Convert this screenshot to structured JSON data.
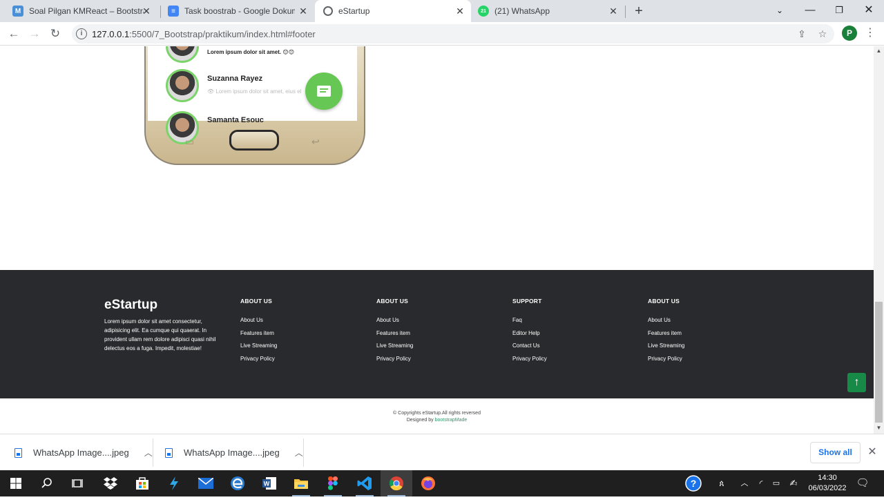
{
  "browser": {
    "tabs": [
      {
        "title": "Soal Pilgan KMReact – Bootstrap",
        "favicon_letter": "M",
        "favicon_color": "#4a90d9"
      },
      {
        "title": "Task boostrab - Google Dokumen",
        "favicon_letter": "≡",
        "favicon_color": "#4285f4"
      },
      {
        "title": "eStartup",
        "favicon_letter": "",
        "favicon_color": "#5f6368",
        "active": true
      },
      {
        "title": "(21) WhatsApp",
        "favicon_letter": "21",
        "favicon_color": "#25d366"
      }
    ],
    "url_host": "127.0.0.1",
    "url_path": ":5500/7_Bootstrap/praktikum/index.html#footer",
    "profile_initial": "P"
  },
  "phone": {
    "chats": [
      {
        "name": "",
        "message": "Lorem ipsum dolor sit amet. 😊😊"
      },
      {
        "name": "Suzanna Rayez",
        "message": "👁 Lorem ipsum dolor sit amet, eius el"
      },
      {
        "name": "Samanta Esouc",
        "message": ""
      }
    ]
  },
  "footer": {
    "brand": "eStartup",
    "description": "Lorem ipsum dolor sit amet consectetur, adipisicing elit. Ea cumque qui quaerat. In provident ullam rem dolore adipisci quasi nihil delectus eos a fuga. Impedit, molestiae!",
    "columns": [
      {
        "heading": "ABOUT US",
        "links": [
          "About Us",
          "Features item",
          "Live Streaming",
          "Privacy Policy"
        ]
      },
      {
        "heading": "ABOUT US",
        "links": [
          "About Us",
          "Features item",
          "Live Streaming",
          "Privacy Policy"
        ]
      },
      {
        "heading": "SUPPORT",
        "links": [
          "Faq",
          "Editor Help",
          "Contact Us",
          "Privacy Policy"
        ]
      },
      {
        "heading": "ABOUT US",
        "links": [
          "About Us",
          "Features item",
          "Live Streaming",
          "Privacy Policy"
        ]
      }
    ],
    "copyright": "© Copyrights eStartup.All rights reversed",
    "designed_by_prefix": "Designed by ",
    "designed_by_link": "bootstrapMade"
  },
  "downloads": {
    "items": [
      "WhatsApp Image....jpeg",
      "WhatsApp Image....jpeg"
    ],
    "show_all": "Show all"
  },
  "taskbar": {
    "time": "14:30",
    "date": "06/03/2022"
  },
  "colors": {
    "footer_bg": "#292a2d",
    "accent_green": "#188a47",
    "fab_green": "#67c755"
  }
}
